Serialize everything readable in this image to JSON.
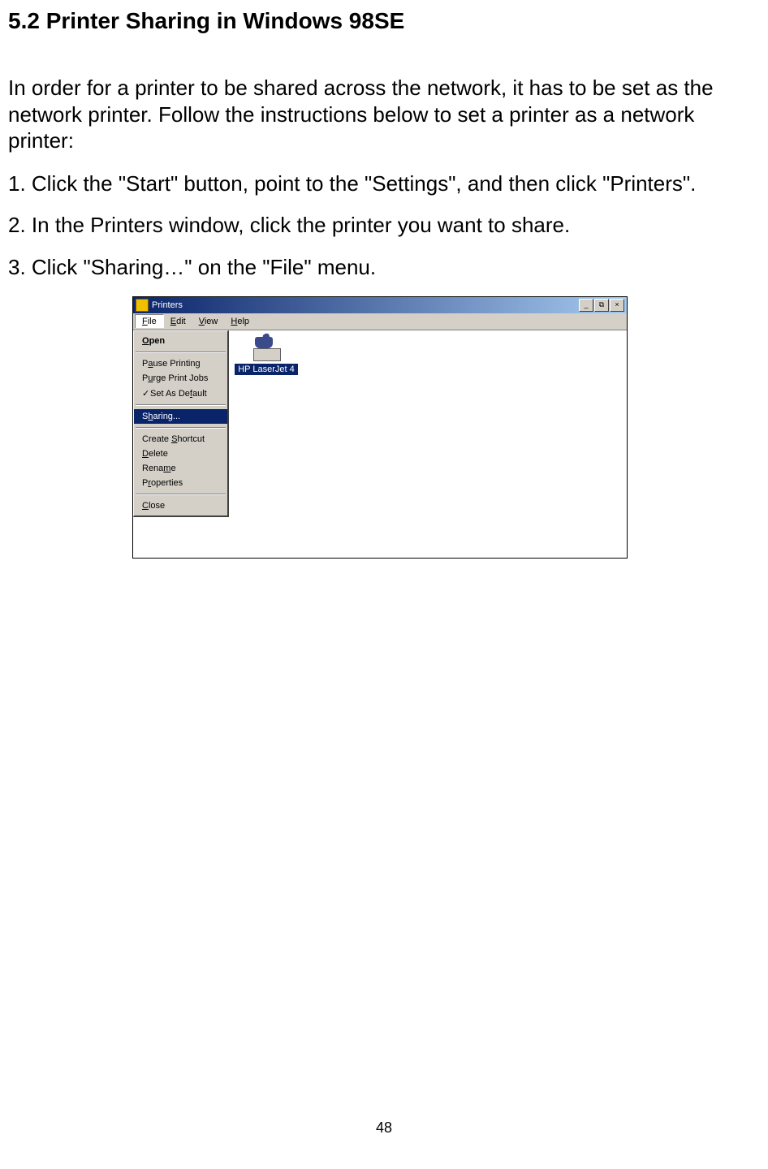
{
  "section_title": "5.2 Printer Sharing in Windows 98SE",
  "intro_text": "In order for a printer to be shared across the network, it has to be set as the network printer.  Follow the instructions below to set a printer as a network printer:",
  "steps": [
    "1.  Click the \"Start\" button, point to the \"Settings\", and then click \"Printers\".",
    "2.  In the Printers window, click the printer you want to share.",
    "3.  Click \"Sharing…\" on the \"File\" menu."
  ],
  "window": {
    "title": "Printers",
    "menus": [
      "File",
      "Edit",
      "View",
      "Help"
    ],
    "file_menu": {
      "group1": [
        "Open"
      ],
      "group2": [
        "Pause Printing",
        "Purge Print Jobs",
        "Set As Default"
      ],
      "group3": [
        "Sharing..."
      ],
      "group4": [
        "Create Shortcut",
        "Delete",
        "Rename",
        "Properties"
      ],
      "group5": [
        "Close"
      ],
      "default_item": "Set As Default",
      "selected_item": "Sharing..."
    },
    "printer_label": "HP LaserJet 4"
  },
  "page_number": "48"
}
